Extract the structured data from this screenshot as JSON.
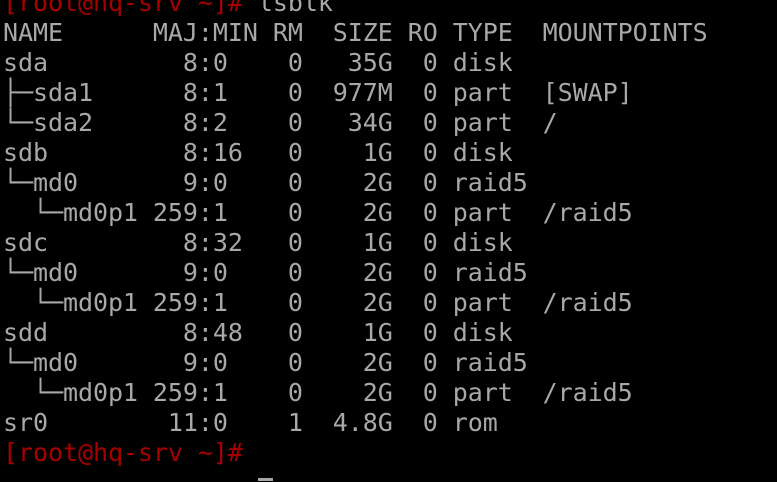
{
  "terminal": {
    "prompt_top": "[root@hq-srv ~]#",
    "command": " lsblk",
    "header": "NAME      MAJ:MIN RM  SIZE RO TYPE  MOUNTPOINTS",
    "rows": [
      "sda         8:0    0   35G  0 disk",
      "├─sda1      8:1    0  977M  0 part  [SWAP]",
      "└─sda2      8:2    0   34G  0 part  /",
      "sdb         8:16   0    1G  0 disk",
      "└─md0       9:0    0    2G  0 raid5",
      "  └─md0p1 259:1    0    2G  0 part  /raid5",
      "sdc         8:32   0    1G  0 disk",
      "└─md0       9:0    0    2G  0 raid5",
      "  └─md0p1 259:1    0    2G  0 part  /raid5",
      "sdd         8:48   0    1G  0 disk",
      "└─md0       9:0    0    2G  0 raid5",
      "  └─md0p1 259:1    0    2G  0 part  /raid5",
      "sr0        11:0    1  4.8G  0 rom"
    ],
    "prompt_bottom": "[root@hq-srv ~]#",
    "colors": {
      "background": "#000000",
      "text": "#a8a8a8",
      "prompt": "#a80000"
    }
  }
}
